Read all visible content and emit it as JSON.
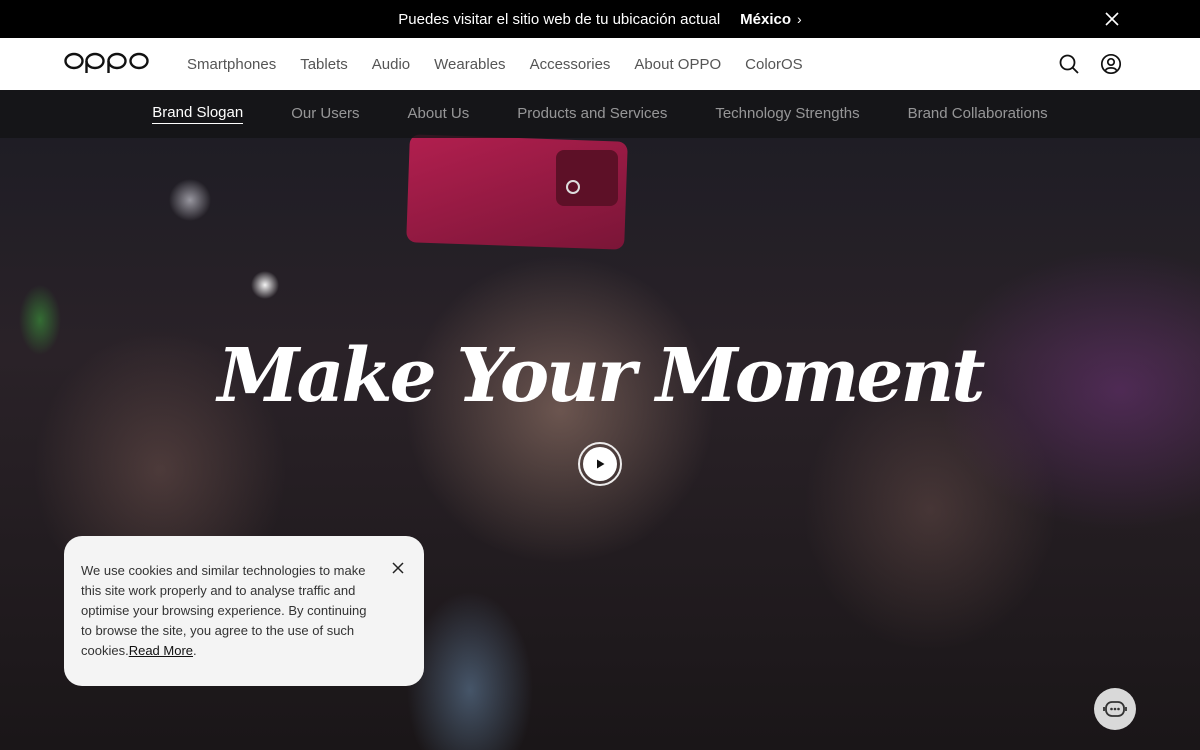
{
  "banner": {
    "message": "Puedes visitar el sitio web de tu ubicación actual",
    "location_link": "México",
    "chevron_glyph": "›"
  },
  "nav": {
    "logo_text": "oppo",
    "items": [
      {
        "label": "Smartphones"
      },
      {
        "label": "Tablets"
      },
      {
        "label": "Audio"
      },
      {
        "label": "Wearables"
      },
      {
        "label": "Accessories"
      },
      {
        "label": "About OPPO"
      },
      {
        "label": "ColorOS"
      }
    ],
    "icons": [
      "search-icon",
      "account-icon"
    ]
  },
  "sub_nav": {
    "items": [
      {
        "label": "Brand Slogan",
        "active": true
      },
      {
        "label": "Our Users",
        "active": false
      },
      {
        "label": "About Us",
        "active": false
      },
      {
        "label": "Products and Services",
        "active": false
      },
      {
        "label": "Technology Strengths",
        "active": false
      },
      {
        "label": "Brand Collaborations",
        "active": false
      }
    ]
  },
  "hero": {
    "title": "Make Your Moment",
    "play_icon": "play-icon"
  },
  "cookie": {
    "text": "We use cookies and similar technologies to make this site work properly and to analyse traffic and optimise your browsing experience. By continuing to browse the site, you agree to the use of such cookies.",
    "link": "Read More",
    "suffix": "."
  },
  "chat": {
    "icon": "chat-bot-icon"
  },
  "colors": {
    "banner_bg": "#000000",
    "nav_bg": "#ffffff",
    "nav_text": "#555555",
    "subnav_bg": "#141416",
    "cookie_bg": "#f4f4f4"
  }
}
